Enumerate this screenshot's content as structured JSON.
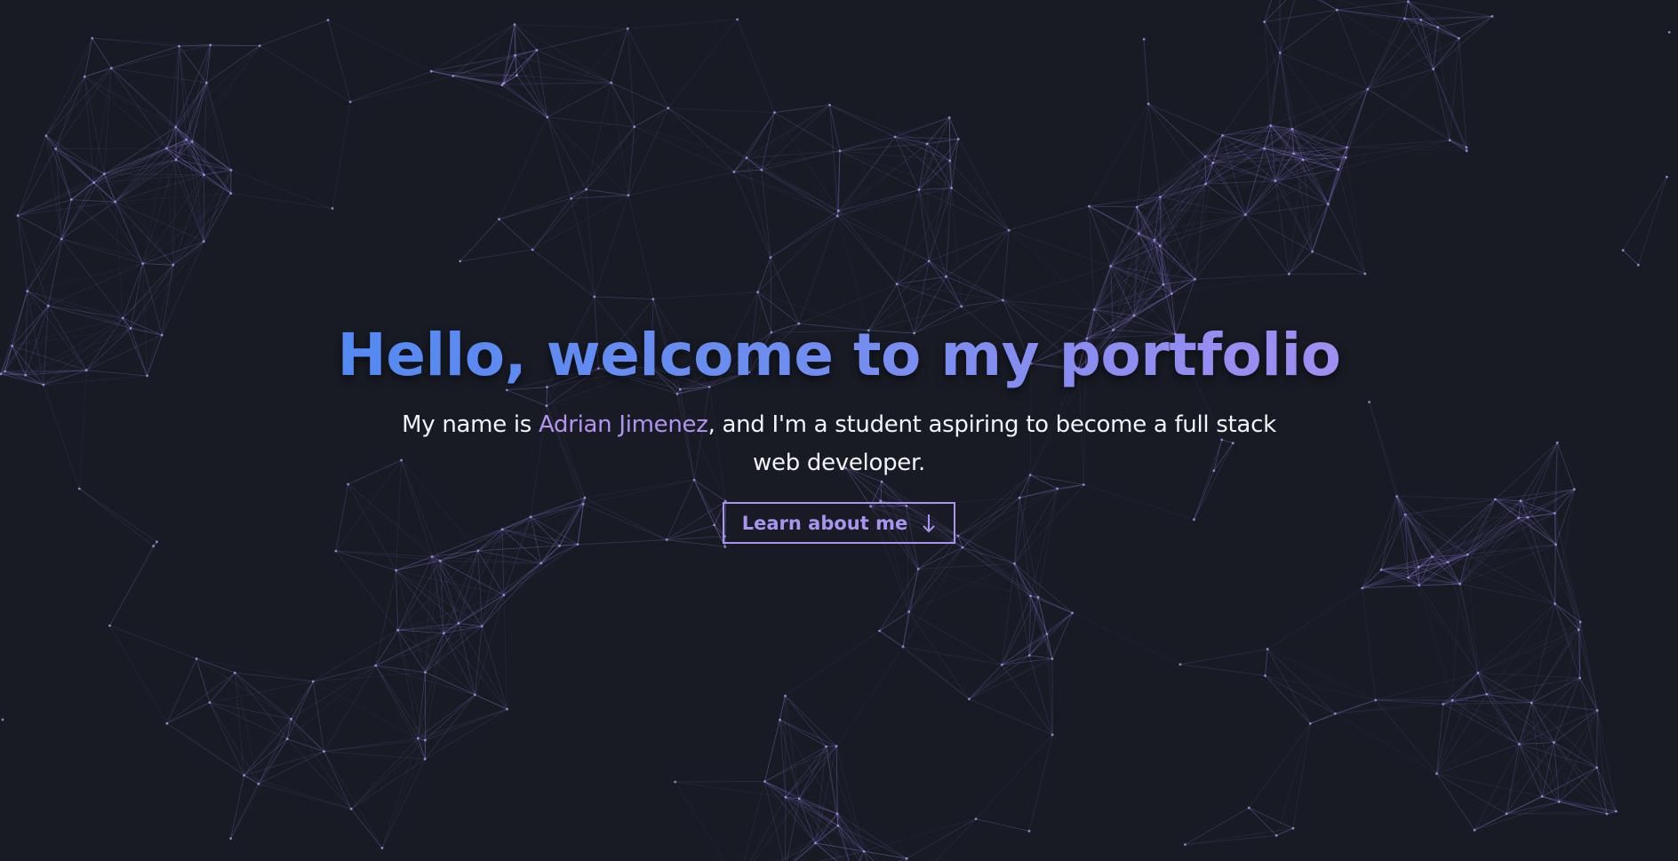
{
  "hero": {
    "title": "Hello, welcome to my portfolio",
    "subtitle_prefix": "My name is ",
    "subtitle_name": "Adrian Jimenez",
    "subtitle_suffix": ", and I'm a student aspiring to become a full stack web developer.",
    "cta_label": "Learn about me",
    "cta_icon": "arrow-down-icon"
  },
  "colors": {
    "background": "#181b24",
    "gradient_start": "#3f86f4",
    "gradient_end": "#b197ef",
    "accent": "#a994ef",
    "network_line": "#8a78d8",
    "network_dot": "#b2a4f5"
  }
}
